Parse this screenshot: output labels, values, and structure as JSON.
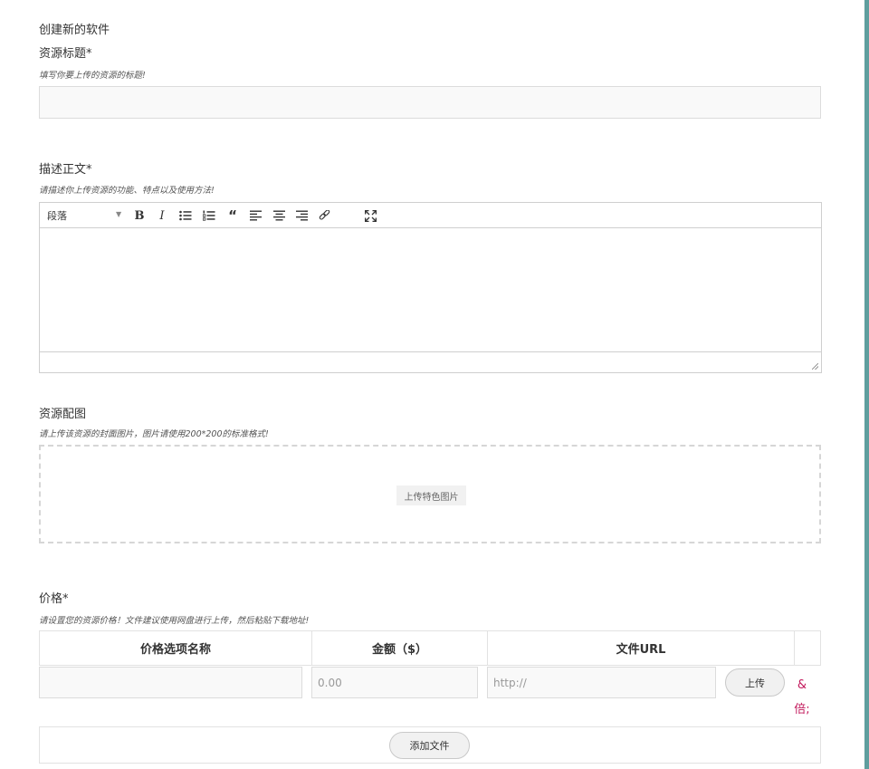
{
  "page": {
    "title": "创建新的软件"
  },
  "resource_title": {
    "label": "资源标题*",
    "hint": "填写你要上传的资源的标题!",
    "value": ""
  },
  "description": {
    "label": "描述正文*",
    "hint": "请描述你上传资源的功能、特点以及使用方法!",
    "toolbar": {
      "format_select": "段落",
      "bold": "B",
      "italic": "I",
      "icons": [
        "bulleted-list-icon",
        "numbered-list-icon",
        "blockquote-icon",
        "align-left-icon",
        "align-center-icon",
        "align-right-icon",
        "link-icon",
        "fullscreen-icon"
      ]
    },
    "content": ""
  },
  "featured_image": {
    "label": "资源配图",
    "hint": "请上传该资源的封面图片，图片请使用200*200的标准格式!",
    "button": "上传特色图片"
  },
  "pricing": {
    "label": "价格*",
    "hint": "请设置您的资源价格！文件建议使用网盘进行上传，然后粘贴下载地址!",
    "columns": [
      "价格选项名称",
      "金额（$）",
      "文件URL",
      ""
    ],
    "rows": [
      {
        "name": "",
        "amount_placeholder": "0.00",
        "url_placeholder": "http://",
        "upload_button": "上传",
        "delete_text": "&倍;"
      }
    ],
    "add_button": "添加文件"
  },
  "colors": {
    "accent_bar": "#5e9e9e",
    "delete_link": "#c2185b",
    "input_bg": "#f9f9f9"
  }
}
